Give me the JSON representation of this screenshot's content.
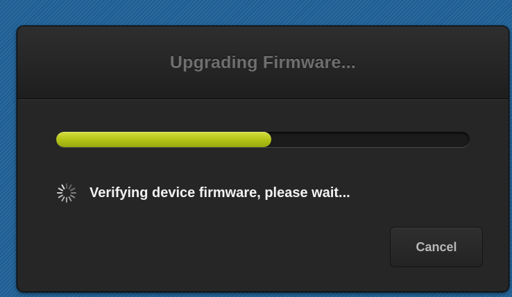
{
  "dialog": {
    "title": "Upgrading Firmware...",
    "progress": {
      "percent": 52,
      "fill_color": "#b1c117"
    },
    "status": {
      "icon": "spinner-icon",
      "text": "Verifying device firmware, please wait..."
    },
    "cancel_label": "Cancel"
  },
  "colors": {
    "background": "#1f5f94",
    "dialog": "#262626",
    "title_text": "#6f6f6f",
    "status_text": "#f2f2f2",
    "button_text": "#b8b8b8"
  }
}
